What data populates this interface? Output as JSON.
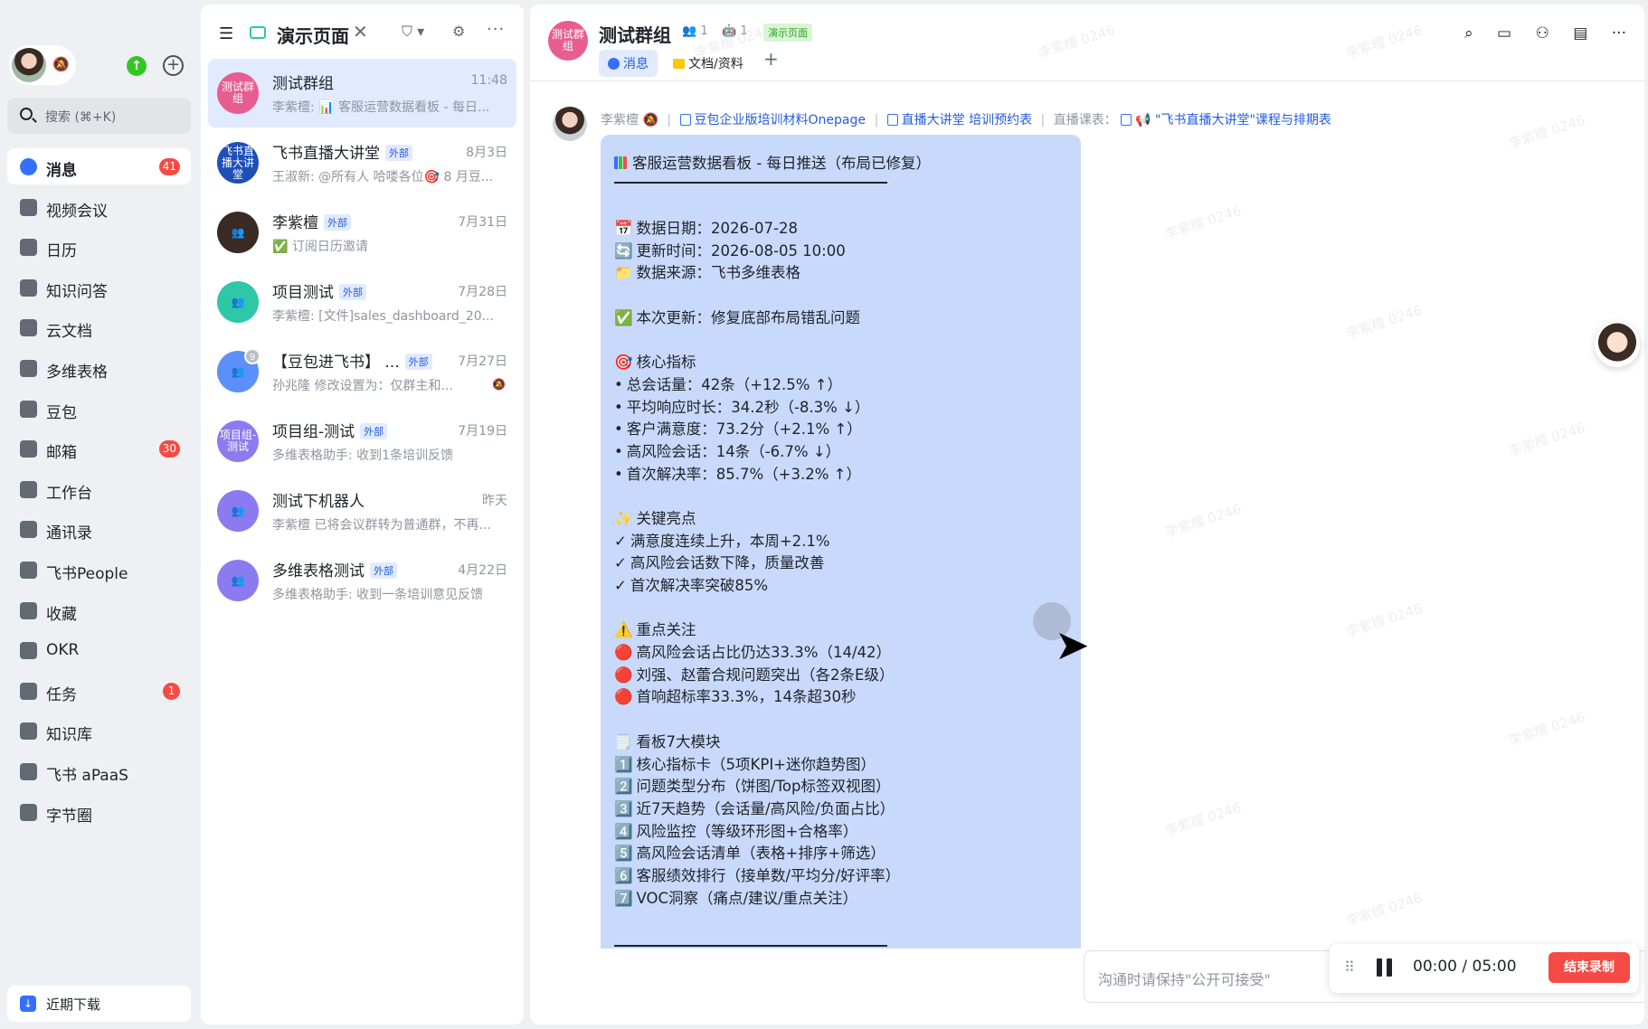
{
  "sidebar": {
    "search_placeholder": "搜索 (⌘+K)",
    "nav": [
      {
        "label": "消息",
        "badge": "41",
        "icon": "message-icon",
        "active": true
      },
      {
        "label": "视频会议",
        "badge": "",
        "icon": "video-icon"
      },
      {
        "label": "日历",
        "badge": "",
        "icon": "calendar-icon"
      },
      {
        "label": "知识问答",
        "badge": "",
        "icon": "qa-icon"
      },
      {
        "label": "云文档",
        "badge": "",
        "icon": "docs-icon"
      },
      {
        "label": "多维表格",
        "badge": "",
        "icon": "base-icon"
      },
      {
        "label": "豆包",
        "badge": "",
        "icon": "doubao-icon"
      },
      {
        "label": "邮箱",
        "badge": "30",
        "icon": "mail-icon"
      },
      {
        "label": "工作台",
        "badge": "",
        "icon": "workplace-icon"
      },
      {
        "label": "通讯录",
        "badge": "",
        "icon": "contacts-icon"
      },
      {
        "label": "飞书People",
        "badge": "",
        "icon": "people-icon"
      },
      {
        "label": "收藏",
        "badge": "",
        "icon": "star-icon"
      },
      {
        "label": "OKR",
        "badge": "",
        "icon": "okr-icon"
      },
      {
        "label": "任务",
        "badge": "1",
        "icon": "task-icon"
      },
      {
        "label": "知识库",
        "badge": "",
        "icon": "wiki-icon"
      },
      {
        "label": "飞书 aPaaS",
        "badge": "",
        "icon": "apaas-icon"
      },
      {
        "label": "字节圈",
        "badge": "",
        "icon": "circle-icon"
      }
    ],
    "recent_download": "近期下载"
  },
  "chatlist": {
    "title": "演示页面",
    "ext_label": "外部",
    "chats": [
      {
        "avatar_text": "测试群组",
        "avatar_color": "#e85d8f",
        "name": "测试群组",
        "external": false,
        "time": "11:48",
        "preview": "李紫檀: 📊 客服运营数据看板 - 每日...",
        "active": true
      },
      {
        "avatar_text": "飞书直播大讲堂",
        "avatar_color": "#1e4fb8",
        "name": "飞书直播大讲堂",
        "external": true,
        "time": "8月3日",
        "preview": "王淑新: @所有人 哈喽各位🎯 8 月豆..."
      },
      {
        "avatar_text": "",
        "avatar_color": "#3a2a24",
        "name": "李紫檀",
        "external": true,
        "time": "7月31日",
        "preview": "✅ 订阅日历邀请"
      },
      {
        "avatar_text": "",
        "avatar_color": "#2ec7a7",
        "name": "项目测试",
        "external": true,
        "time": "7月28日",
        "preview": "李紫檀: [文件]sales_dashboard_20..."
      },
      {
        "avatar_text": "",
        "avatar_color": "#5b8ff9",
        "name": "【豆包进飞书】 ...",
        "external": true,
        "time": "7月27日",
        "preview": "孙兆隆 修改设置为：仅群主和...",
        "count": "9",
        "muted": true
      },
      {
        "avatar_text": "项目组-测试",
        "avatar_color": "#8b7bf0",
        "name": "项目组-测试",
        "external": true,
        "time": "7月19日",
        "preview": "多维表格助手: 收到1条培训反馈"
      },
      {
        "avatar_text": "",
        "avatar_color": "#8b7bf0",
        "name": "测试下机器人",
        "external": false,
        "time": "昨天",
        "preview": "李紫檀 已将会议群转为普通群，不再..."
      },
      {
        "avatar_text": "",
        "avatar_color": "#8b7bf0",
        "name": "多维表格测试",
        "external": true,
        "time": "4月22日",
        "preview": "多维表格助手: 收到一条培训意见反馈"
      }
    ]
  },
  "main": {
    "avatar_text": "测试群组",
    "title": "测试群组",
    "members": "1",
    "bots": "1",
    "tag": "演示页面",
    "tabs": [
      {
        "label": "消息",
        "active": true
      },
      {
        "label": "文档/资料",
        "active": false
      }
    ],
    "sender": "李紫檀",
    "meta_links": [
      "豆包企业版培训材料Onepage",
      "直播大讲堂 培训预约表"
    ],
    "meta_plain": "直播课表：",
    "meta_link3": "📢 \"飞书直播大讲堂\"课程与排期表",
    "card_title": "客服运营数据看板 - 每日推送（布局已修复）",
    "card_lines": [
      {
        "prefix": "📅",
        "text": "数据日期：2026-07-28"
      },
      {
        "prefix": "🔄",
        "text": "更新时间：2026-08-05 10:00"
      },
      {
        "prefix": "📁",
        "text": "数据来源：飞书多维表格"
      },
      {
        "gap": true
      },
      {
        "prefix": "✅",
        "text": "本次更新：修复底部布局错乱问题"
      },
      {
        "gap": true
      },
      {
        "prefix": "🎯",
        "text": "核心指标"
      },
      {
        "prefix": "•",
        "text": "总会话量：42条（+12.5% ↑）"
      },
      {
        "prefix": "•",
        "text": "平均响应时长：34.2秒（-8.3% ↓）"
      },
      {
        "prefix": "•",
        "text": "客户满意度：73.2分（+2.1% ↑）"
      },
      {
        "prefix": "•",
        "text": "高风险会话：14条（-6.7% ↓）"
      },
      {
        "prefix": "•",
        "text": "首次解决率：85.7%（+3.2% ↑）"
      },
      {
        "gap": true
      },
      {
        "prefix": "✨",
        "text": "关键亮点"
      },
      {
        "prefix": "✓",
        "text": "满意度连续上升，本周+2.1%"
      },
      {
        "prefix": "✓",
        "text": "高风险会话数下降，质量改善"
      },
      {
        "prefix": "✓",
        "text": "首次解决率突破85%"
      },
      {
        "gap": true
      },
      {
        "prefix": "⚠️",
        "text": "重点关注"
      },
      {
        "prefix": "🔴",
        "text": "高风险会话占比仍达33.3%（14/42）"
      },
      {
        "prefix": "🔴",
        "text": "刘强、赵蕾合规问题突出（各2条E级）"
      },
      {
        "prefix": "🔴",
        "text": "首响超标率33.3%，14条超30秒"
      },
      {
        "gap": true
      },
      {
        "prefix": "🗒️",
        "text": "看板7大模块"
      },
      {
        "prefix": "1️⃣",
        "text": "核心指标卡（5项KPI+迷你趋势图）"
      },
      {
        "prefix": "2️⃣",
        "text": "问题类型分布（饼图/Top标签双视图）"
      },
      {
        "prefix": "3️⃣",
        "text": "近7天趋势（会话量/高风险/负面占比）"
      },
      {
        "prefix": "4️⃣",
        "text": "风险监控（等级环形图+合格率）"
      },
      {
        "prefix": "5️⃣",
        "text": "高风险会话清单（表格+排序+筛选）"
      },
      {
        "prefix": "6️⃣",
        "text": "客服绩效排行（接单数/平均分/好评率）"
      },
      {
        "prefix": "7️⃣",
        "text": "VOC洞察（痛点/建议/重点关注）"
      }
    ],
    "composer_placeholder": "沟通时请保持\"公开可接受\"",
    "recorder": {
      "elapsed": "00:00",
      "separator": "/",
      "total": "05:00",
      "stop_label": "结束录制"
    },
    "watermark": "李紫檀 0246"
  }
}
